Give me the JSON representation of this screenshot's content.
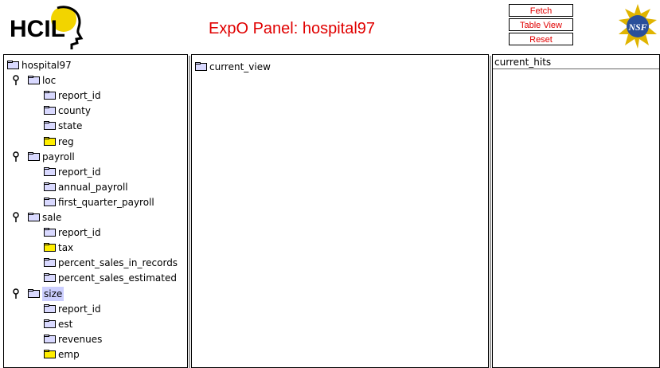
{
  "header": {
    "logo_text": "HCIL",
    "title": "ExpO Panel: hospital97",
    "buttons": {
      "fetch": "Fetch",
      "table_view": "Table View",
      "reset": "Reset"
    },
    "seal_text": "NSF"
  },
  "tree": {
    "root": "hospital97",
    "groups": [
      {
        "label": "loc",
        "children": [
          "report_id",
          "county",
          "state",
          "reg"
        ]
      },
      {
        "label": "payroll",
        "children": [
          "report_id",
          "annual_payroll",
          "first_quarter_payroll"
        ]
      },
      {
        "label": "sale",
        "children": [
          "report_id",
          "tax",
          "percent_sales_in_records",
          "percent_sales_estimated"
        ]
      },
      {
        "label": "size",
        "children": [
          "report_id",
          "est",
          "revenues",
          "emp"
        ]
      }
    ]
  },
  "view": {
    "root": "current_view"
  },
  "hits": {
    "header": "current_hits"
  },
  "colors": {
    "title_red": "#e00000",
    "folder_default": "#d9d9ff",
    "folder_highlight": "#ffee00",
    "selected_bg": "#cccfff"
  }
}
